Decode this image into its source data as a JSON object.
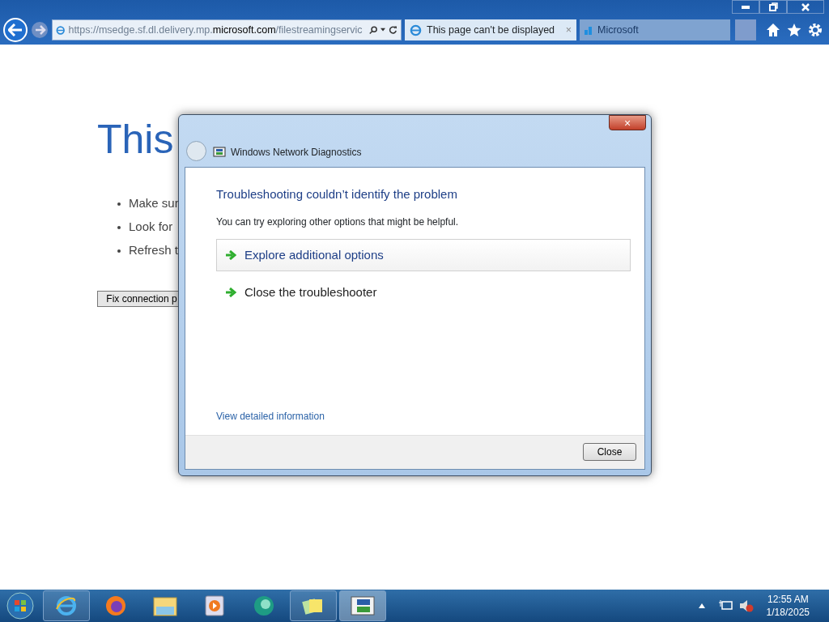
{
  "browser": {
    "address": {
      "prefix": "https://msedge.sf.dl.delivery.mp.",
      "domain": "microsoft.com",
      "suffix": "/filestreamingservic"
    },
    "tabs": [
      {
        "label": "This page can't be displayed",
        "selected": true,
        "close": "×"
      },
      {
        "label": "Microsoft",
        "selected": false
      }
    ]
  },
  "page": {
    "heading": "This",
    "bullets": [
      "Make sur",
      "Look for",
      "Refresh t"
    ],
    "button": "Fix connection p"
  },
  "dialog": {
    "title": "Windows Network Diagnostics",
    "close": "×",
    "heading": "Troubleshooting couldn’t identify the problem",
    "message": "You can try exploring other options that might be helpful.",
    "options": [
      {
        "label": "Explore additional options",
        "selected": true
      },
      {
        "label": "Close the troubleshooter",
        "selected": false
      }
    ],
    "details_link": "View detailed information",
    "button": "Close"
  },
  "taskbar": {
    "time": "12:55 AM",
    "date": "1/18/2025"
  }
}
